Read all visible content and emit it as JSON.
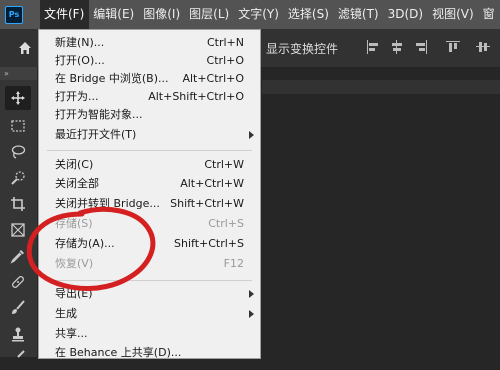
{
  "app": {
    "logo_text": "Ps"
  },
  "menubar": {
    "items": [
      {
        "label": "文件(F)"
      },
      {
        "label": "编辑(E)"
      },
      {
        "label": "图像(I)"
      },
      {
        "label": "图层(L)"
      },
      {
        "label": "文字(Y)"
      },
      {
        "label": "选择(S)"
      },
      {
        "label": "滤镜(T)"
      },
      {
        "label": "3D(D)"
      },
      {
        "label": "视图(V)"
      },
      {
        "label": "窗"
      }
    ]
  },
  "optionsbar": {
    "show_transform_label": "显示变换控件"
  },
  "panelstrip": {
    "expand_label": "»"
  },
  "toolbar": {
    "tools": [
      "move-tool",
      "marquee-tool",
      "lasso-tool",
      "quick-select-tool",
      "crop-tool",
      "frame-tool",
      "eyedropper-tool",
      "healing-brush-tool",
      "brush-tool",
      "stamp-tool",
      "history-brush-tool"
    ]
  },
  "file_menu": {
    "items": [
      {
        "label": "新建(N)...",
        "shortcut": "Ctrl+N",
        "enabled": true,
        "submenu": false
      },
      {
        "label": "打开(O)...",
        "shortcut": "Ctrl+O",
        "enabled": true,
        "submenu": false
      },
      {
        "label": "在 Bridge 中浏览(B)...",
        "shortcut": "Alt+Ctrl+O",
        "enabled": true,
        "submenu": false
      },
      {
        "label": "打开为...",
        "shortcut": "Alt+Shift+Ctrl+O",
        "enabled": true,
        "submenu": false
      },
      {
        "label": "打开为智能对象...",
        "shortcut": "",
        "enabled": true,
        "submenu": false
      },
      {
        "label": "最近打开文件(T)",
        "shortcut": "",
        "enabled": true,
        "submenu": true
      },
      {
        "label": "关闭(C)",
        "shortcut": "Ctrl+W",
        "enabled": true,
        "submenu": false
      },
      {
        "label": "关闭全部",
        "shortcut": "Alt+Ctrl+W",
        "enabled": true,
        "submenu": false
      },
      {
        "label": "关闭并转到 Bridge...",
        "shortcut": "Shift+Ctrl+W",
        "enabled": true,
        "submenu": false
      },
      {
        "label": "存储(S)",
        "shortcut": "Ctrl+S",
        "enabled": false,
        "submenu": false
      },
      {
        "label": "存储为(A)...",
        "shortcut": "Shift+Ctrl+S",
        "enabled": true,
        "submenu": false
      },
      {
        "label": "恢复(V)",
        "shortcut": "F12",
        "enabled": false,
        "submenu": false
      },
      {
        "label": "导出(E)",
        "shortcut": "",
        "enabled": true,
        "submenu": true
      },
      {
        "label": "生成",
        "shortcut": "",
        "enabled": true,
        "submenu": true
      },
      {
        "label": "共享...",
        "shortcut": "",
        "enabled": true,
        "submenu": false
      },
      {
        "label": "在 Behance 上共享(D)...",
        "shortcut": "",
        "enabled": true,
        "submenu": false
      }
    ]
  },
  "colors": {
    "menubar_bg": "#535353",
    "menu_bg": "#f0f0f0",
    "disabled_text": "#9a9a9a",
    "annotation": "#d42020",
    "ps_blue": "#31a8ff"
  }
}
